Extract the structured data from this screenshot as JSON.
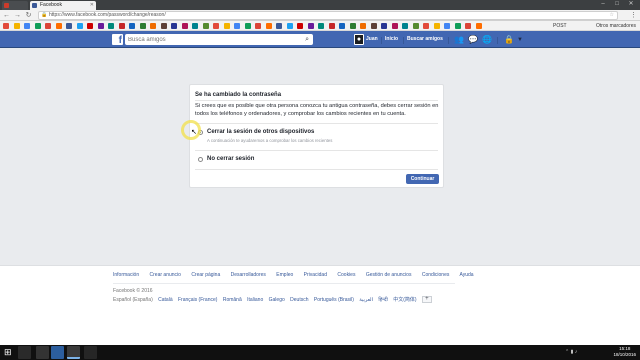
{
  "browser": {
    "tabs": [
      {
        "label": "",
        "color": "#cc3b2b"
      },
      {
        "label": "Facebook",
        "color": "#3b5998"
      }
    ],
    "url": "https://www.facebook.com/password/change/reason/",
    "bookmarks_right": [
      "POST",
      "Otros marcadores"
    ]
  },
  "fb": {
    "logo": "f",
    "search_placeholder": "Busca amigos",
    "user": "Juan",
    "nav": [
      "Inicio",
      "Buscar amigos"
    ]
  },
  "dialog": {
    "title": "Se ha cambiado la contraseña",
    "body": "Si crees que es posible que otra persona conozca tu antigua contraseña, debes cerrar sesión en todos los teléfonos y ordenadores, y comprobar los cambios recientes en tu cuenta.",
    "options": [
      {
        "label": "Cerrar la sesión de otros dispositivos",
        "sub": "A continuación te ayudaremos a comprobar los cambios recientes",
        "checked": true
      },
      {
        "label": "No cerrar sesión",
        "sub": "",
        "checked": false
      }
    ],
    "continue_label": "Continuar"
  },
  "footer": {
    "links": [
      "Información",
      "Crear anuncio",
      "Crear página",
      "Desarrolladores",
      "Empleo",
      "Privacidad",
      "Cookies",
      "Gestión de anuncios",
      "Condiciones",
      "Ayuda"
    ],
    "copyright": "Facebook © 2016",
    "languages": [
      "Español (España)",
      "Català",
      "Français (France)",
      "Română",
      "Italiano",
      "Galego",
      "Deutsch",
      "Português (Brasil)",
      "العربية",
      "हिन्दी",
      "中文(简体)"
    ],
    "add_language": "+"
  },
  "taskbar": {
    "time": "15:18",
    "date": "18/10/2016"
  },
  "colors": {
    "fb_blue": "#4267b2",
    "page_bg": "#e9ebee"
  }
}
